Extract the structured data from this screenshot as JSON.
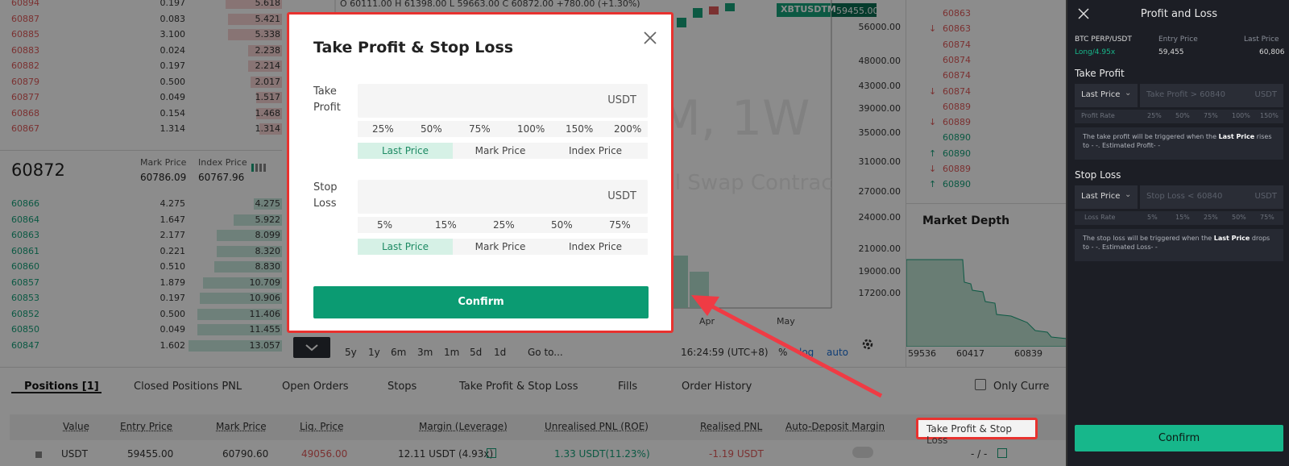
{
  "orderbook": {
    "asks": [
      {
        "price": "60894",
        "qty": "0.197",
        "total": "5.618",
        "depth": 0.2
      },
      {
        "price": "60887",
        "qty": "0.083",
        "total": "5.421",
        "depth": 0.19
      },
      {
        "price": "60885",
        "qty": "3.100",
        "total": "5.338",
        "depth": 0.19
      },
      {
        "price": "60883",
        "qty": "0.024",
        "total": "2.238",
        "depth": 0.12
      },
      {
        "price": "60882",
        "qty": "0.197",
        "total": "2.214",
        "depth": 0.12
      },
      {
        "price": "60879",
        "qty": "0.500",
        "total": "2.017",
        "depth": 0.11
      },
      {
        "price": "60877",
        "qty": "0.049",
        "total": "1.517",
        "depth": 0.09
      },
      {
        "price": "60868",
        "qty": "0.154",
        "total": "1.468",
        "depth": 0.09
      },
      {
        "price": "60867",
        "qty": "1.314",
        "total": "1.314",
        "depth": 0.08
      }
    ],
    "last_price": "60872",
    "mark_label": "Mark Price",
    "mark_value": "60786.09",
    "index_label": "Index Price",
    "index_value": "60767.96",
    "bids": [
      {
        "price": "60866",
        "qty": "4.275",
        "total": "4.275",
        "depth": 0.1
      },
      {
        "price": "60864",
        "qty": "1.647",
        "total": "5.922",
        "depth": 0.17
      },
      {
        "price": "60863",
        "qty": "2.177",
        "total": "8.099",
        "depth": 0.23
      },
      {
        "price": "60861",
        "qty": "0.221",
        "total": "8.320",
        "depth": 0.23
      },
      {
        "price": "60860",
        "qty": "0.510",
        "total": "8.830",
        "depth": 0.24
      },
      {
        "price": "60857",
        "qty": "1.879",
        "total": "10.709",
        "depth": 0.28
      },
      {
        "price": "60853",
        "qty": "0.197",
        "total": "10.906",
        "depth": 0.29
      },
      {
        "price": "60852",
        "qty": "0.500",
        "total": "11.406",
        "depth": 0.3
      },
      {
        "price": "60850",
        "qty": "0.049",
        "total": "11.455",
        "depth": 0.3
      },
      {
        "price": "60847",
        "qty": "1.602",
        "total": "13.057",
        "depth": 0.33
      }
    ]
  },
  "chart": {
    "ohlc": "O 60111.00  H 61398.00  L 59663.00  C 60872.00  +780.00 (+1.30%)",
    "symbol": "XBTUSDTM",
    "price_tag": "59455.00",
    "watermark": "M, 1W",
    "watermark2": "al Swap Contrac",
    "yticks": [
      "56000.00",
      "48000.00",
      "43000.00",
      "39000.00",
      "35000.00",
      "31000.00",
      "27000.00",
      "24000.00",
      "21000.00",
      "19000.00",
      "17200.00"
    ],
    "xticks": [
      "Apr",
      "May"
    ],
    "ranges": [
      "5y",
      "1y",
      "6m",
      "3m",
      "1m",
      "5d",
      "1d"
    ],
    "goto": "Go to...",
    "time": "16:24:59 (UTC+8)",
    "pct": "%",
    "log": "log",
    "auto": "auto"
  },
  "trades": {
    "rows": [
      {
        "arrow": "",
        "price": "60863"
      },
      {
        "arrow": "↓",
        "price": "60863"
      },
      {
        "arrow": "",
        "price": "60874"
      },
      {
        "arrow": "",
        "price": "60874"
      },
      {
        "arrow": "",
        "price": "60874"
      },
      {
        "arrow": "↓",
        "price": "60874"
      },
      {
        "arrow": "",
        "price": "60889"
      },
      {
        "arrow": "↓",
        "price": "60889"
      },
      {
        "arrow": "",
        "price": "60890"
      },
      {
        "arrow": "↑",
        "price": "60890"
      },
      {
        "arrow": "↓",
        "price": "60889"
      },
      {
        "arrow": "↑",
        "price": "60890"
      }
    ],
    "depth_title": "Market Depth",
    "depth_ticks": [
      "59536",
      "60417",
      "60839"
    ]
  },
  "tabs": [
    "Positions [1]",
    "Closed Positions PNL",
    "Open Orders",
    "Stops",
    "Take Profit & Stop Loss",
    "Fills",
    "Order History"
  ],
  "filter_label": "Only Curre",
  "table": {
    "headers": [
      "Value",
      "Entry Price",
      "Mark Price",
      "Liq. Price",
      "Margin (Leverage)",
      "Unrealised PNL (ROE)",
      "Realised PNL",
      "Auto-Deposit Margin",
      "Take Profit & Stop Loss"
    ],
    "row": {
      "value": "USDT",
      "entry": "59455.00",
      "mark": "60790.60",
      "liq": "49056.00",
      "margin": "12.11 USDT (4.93x)",
      "upnl": "1.33 USDT(11.23%)",
      "rpnl": "-1.19 USDT",
      "tpsl": "- / -"
    }
  },
  "modal": {
    "title": "Take Profit & Stop Loss",
    "tp_label": "Take Profit",
    "tp_unit": "USDT",
    "tp_pcts": [
      "25%",
      "50%",
      "75%",
      "100%",
      "150%",
      "200%"
    ],
    "price_types": [
      "Last Price",
      "Mark Price",
      "Index Price"
    ],
    "sl_label": "Stop Loss",
    "sl_unit": "USDT",
    "sl_pcts": [
      "5%",
      "15%",
      "25%",
      "50%",
      "75%"
    ],
    "confirm": "Confirm"
  },
  "mobile": {
    "title": "Profit and Loss",
    "pair": "BTC PERP/USDT",
    "entry_label": "Entry Price",
    "last_label": "Last Price",
    "side": "Long/4.95x",
    "entry": "59,455",
    "last": "60,806",
    "tp_title": "Take Profit",
    "tp_select": "Last Price",
    "tp_placeholder": "Take Profit > 60840",
    "unit": "USDT",
    "rate_label_tp": "Profit Rate",
    "tp_rates": [
      "25%",
      "50%",
      "75%",
      "100%",
      "150%"
    ],
    "tp_note_1": "The take profit will be triggered when the ",
    "tp_note_bold": "Last Price",
    "tp_note_2": " rises to - -. Estimated Profit- -",
    "sl_title": "Stop Loss",
    "sl_select": "Last Price",
    "sl_placeholder": "Stop Loss < 60840",
    "rate_label_sl": "Loss Rate",
    "sl_rates": [
      "5%",
      "15%",
      "25%",
      "50%",
      "75%"
    ],
    "sl_note_1": "The stop loss will be triggered when the ",
    "sl_note_bold": "Last Price",
    "sl_note_2": " drops to - -. Estimated Loss- -",
    "confirm": "Confirm"
  },
  "colors": {
    "accent": "#0b9b72",
    "highlight": "#e8322f",
    "ask": "#e05a5a",
    "bid": "#16a27b"
  }
}
